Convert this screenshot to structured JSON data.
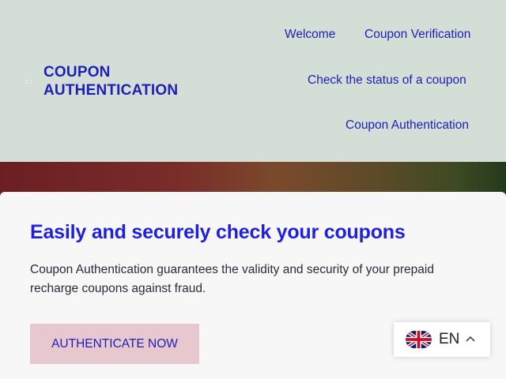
{
  "header": {
    "logo_line1": "COUPON",
    "logo_line2": "AUTHENTICATION",
    "nav": {
      "welcome": "Welcome",
      "verification": "Coupon Verification",
      "status": "Check the status of a coupon",
      "authentication": "Coupon Authentication"
    }
  },
  "hero": {
    "title": "Easily and securely check your coupons",
    "description": "Coupon Authentication guarantees the validity and security of your prepaid recharge coupons against fraud.",
    "cta_label": "AUTHENTICATE NOW"
  },
  "language": {
    "code": "EN",
    "flag_icon": "uk-flag-icon",
    "caret_icon": "chevron-up-icon"
  },
  "colors": {
    "header_bg": "#d3ded6",
    "brand_blue": "#1f1fb8",
    "cta_bg": "#e7c8cf"
  }
}
